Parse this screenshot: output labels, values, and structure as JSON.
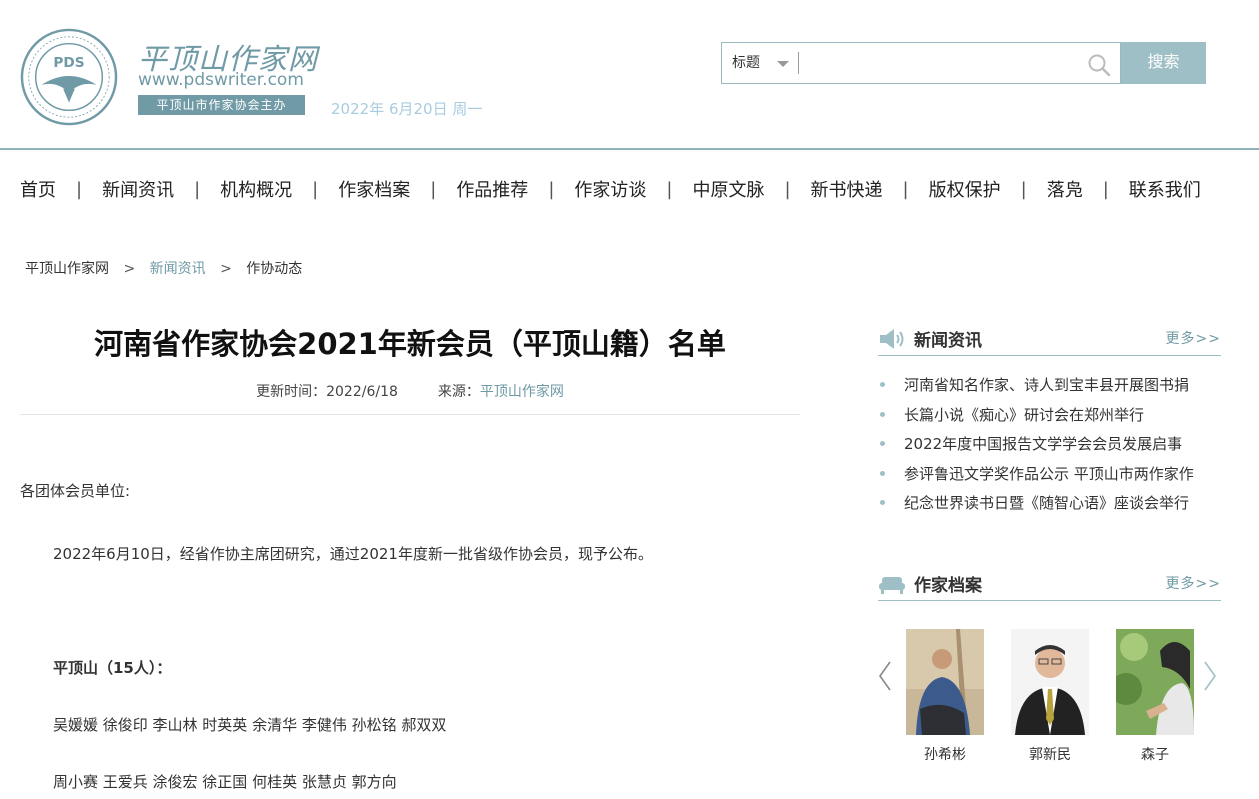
{
  "header": {
    "seal_text": "平顶山市作家协会",
    "seal_abbr": "PDS",
    "logo_text": "平顶山作家网",
    "url": "www.pdswriter.com",
    "host": "平顶山市作家协会主办",
    "date": "2022年 6月20日 周一"
  },
  "search": {
    "select_value": "标题",
    "placeholder": "",
    "button_label": "搜索"
  },
  "nav": [
    "首页",
    "新闻资讯",
    "机构概况",
    "作家档案",
    "作品推荐",
    "作家访谈",
    "中原文脉",
    "新书快递",
    "版权保护",
    "落凫",
    "联系我们"
  ],
  "nav_separator": "|",
  "breadcrumb": {
    "home": "平顶山作家网",
    "sep": ">",
    "section": "新闻资讯",
    "current": "作协动态"
  },
  "article": {
    "title": "河南省作家协会2021年新会员（平顶山籍）名单",
    "updated": "更新时间：2022/6/18",
    "source_label": "来源：",
    "source": "平顶山作家网",
    "salutation": "各团体会员单位:",
    "para1": "2022年6月10日，经省作协主席团研究，通过2021年度新一批省级作协会员，现予公布。",
    "group_title": "平顶山（15人）：",
    "names_line1": "吴媛媛 徐俊印 李山林 时英英 余清华 李健伟 孙松铭 郝双双",
    "names_line2": "周小赛 王爱兵 涂俊宏 徐正国 何桂英 张慧贞 郭方向"
  },
  "sidebar": {
    "news": {
      "title": "新闻资讯",
      "more": "更多>>",
      "items": [
        "河南省知名作家、诗人到宝丰县开展图书捐",
        "长篇小说《痴心》研讨会在郑州举行",
        "2022年度中国报告文学学会会员发展启事",
        "参评鲁迅文学奖作品公示 平顶山市两作家作",
        "纪念世界读书日暨《随智心语》座谈会举行"
      ]
    },
    "writers": {
      "title": "作家档案",
      "more": "更多>>",
      "items": [
        {
          "name": "孙希彬"
        },
        {
          "name": "郭新民"
        },
        {
          "name": "森子"
        }
      ]
    }
  },
  "colors": {
    "accent": "#6f9aa6",
    "accent_light": "#9fbfc6",
    "date": "#a9cce0"
  }
}
